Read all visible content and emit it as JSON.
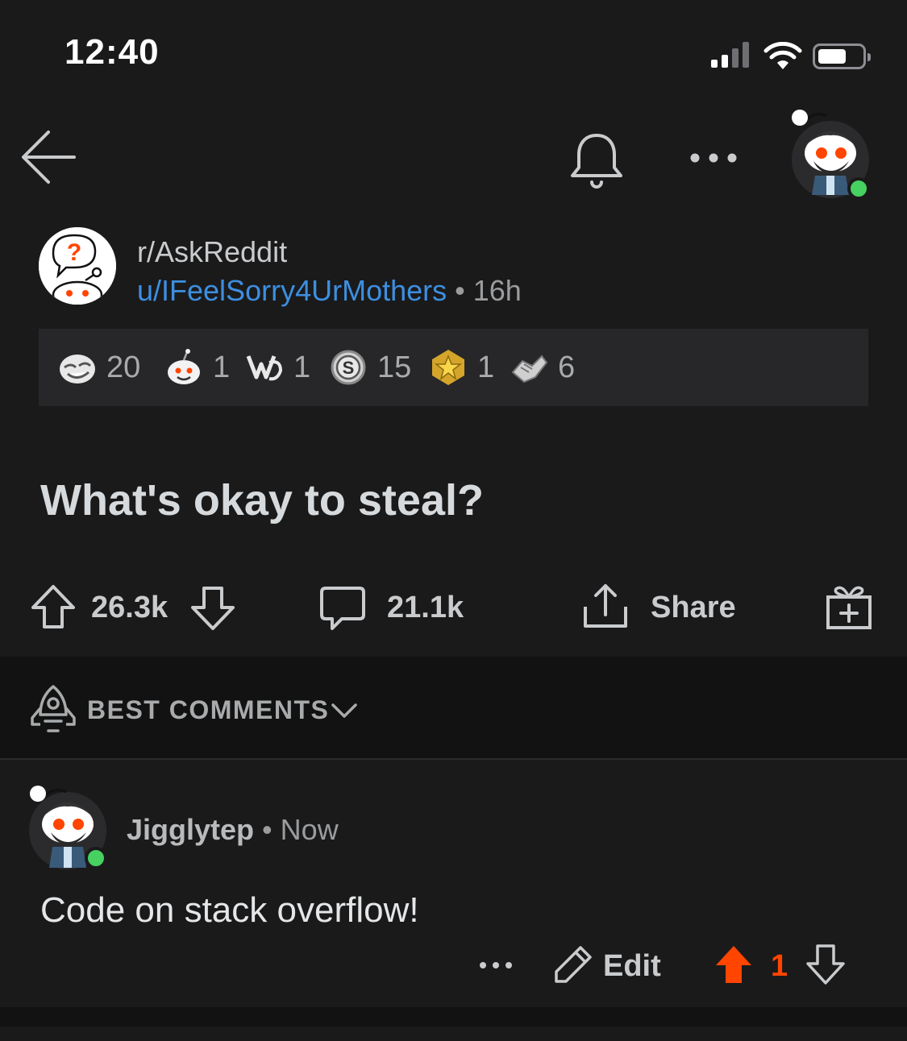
{
  "status_bar": {
    "time": "12:40"
  },
  "post": {
    "subreddit": "r/AskReddit",
    "author": "u/IFeelSorry4UrMothers",
    "separator": "•",
    "age": "16h",
    "title": "What's okay to steal?",
    "awards": [
      {
        "icon": "lol-award-icon",
        "count": "20"
      },
      {
        "icon": "snoo-award-icon",
        "count": "1"
      },
      {
        "icon": "clapping-hands-award-icon",
        "count": "1"
      },
      {
        "icon": "silver-award-icon",
        "count": "15"
      },
      {
        "icon": "gold-award-icon",
        "count": "1"
      },
      {
        "icon": "handshake-award-icon",
        "count": "6"
      }
    ],
    "votes": "26.3k",
    "comments": "21.1k",
    "share_label": "Share"
  },
  "sort": {
    "label": "BEST COMMENTS"
  },
  "comment": {
    "author": "Jigglytep",
    "separator": "•",
    "age": "Now",
    "body": "Code on stack overflow!",
    "edit_label": "Edit",
    "votes": "1"
  },
  "colors": {
    "background": "#1a1a1b",
    "link_blue": "#3d8fe0",
    "upvote_orange": "#ff4500",
    "online_green": "#46d160"
  }
}
